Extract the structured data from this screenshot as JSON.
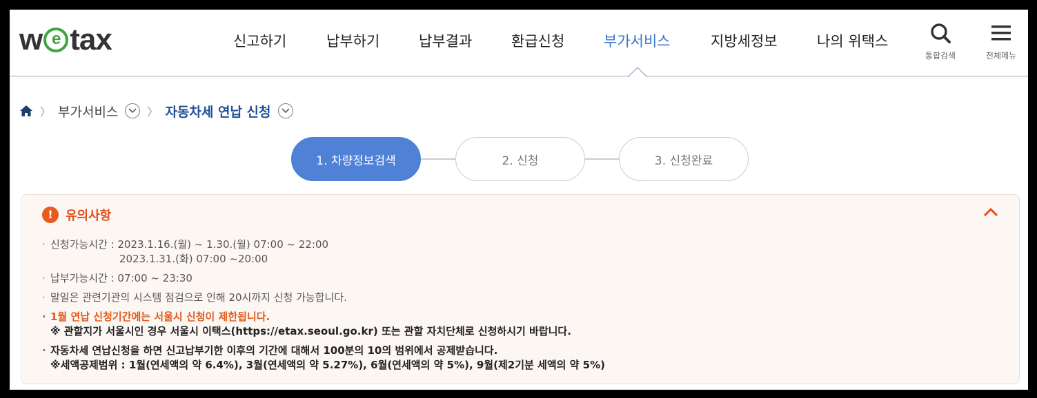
{
  "logo": {
    "text_pre": "w",
    "text_e": "e",
    "text_post": "tax"
  },
  "gnb": {
    "items": [
      {
        "label": "신고하기"
      },
      {
        "label": "납부하기"
      },
      {
        "label": "납부결과"
      },
      {
        "label": "환급신청"
      },
      {
        "label": "부가서비스"
      },
      {
        "label": "지방세정보"
      },
      {
        "label": "나의 위택스"
      }
    ],
    "active_index": 4,
    "search_label": "통합검색",
    "menu_label": "전체메뉴"
  },
  "breadcrumb": {
    "home_icon": "home-icon",
    "level1": "부가서비스",
    "current": "자동차세 연납 신청"
  },
  "steps": [
    {
      "label": "1. 차량정보검색",
      "active": true
    },
    {
      "label": "2. 신청",
      "active": false
    },
    {
      "label": "3. 신청완료",
      "active": false
    }
  ],
  "notice": {
    "title": "유의사항",
    "items": [
      {
        "line1": "신청가능시간 : 2023.1.16.(월) ~ 1.30.(월) 07:00 ~ 22:00",
        "line2": "2023.1.31.(화) 07:00 ~20:00"
      },
      {
        "line1": "납부가능시간 : 07:00 ~ 23:30"
      },
      {
        "line1": "말일은 관련기관의 시스템 점검으로 인해 20시까지 신청 가능합니다."
      },
      {
        "line1": "1월 연납 신청기간에는 서울시 신청이 제한됩니다.",
        "line2": "※ 관할지가 서울시인 경우 서울시 이택스(https://etax.seoul.go.kr) 또는 관할 자치단체로 신청하시기 바랍니다."
      },
      {
        "line1": "자동차세 연납신청을 하면 신고납부기한 이후의 기간에 대해서 100분의 10의 범위에서 공제받습니다.",
        "line2": "※세액공제범위 : 1월(연세액의 약 6.4%), 3월(연세액의 약 5.27%), 6월(연세액의 약 5%), 9월(제2기분 세액의 약 5%)"
      }
    ]
  },
  "colors": {
    "accent": "#4f82d6",
    "active_nav": "#3c74c9",
    "warning": "#e24d1b",
    "logo_green": "#3aa63a"
  }
}
